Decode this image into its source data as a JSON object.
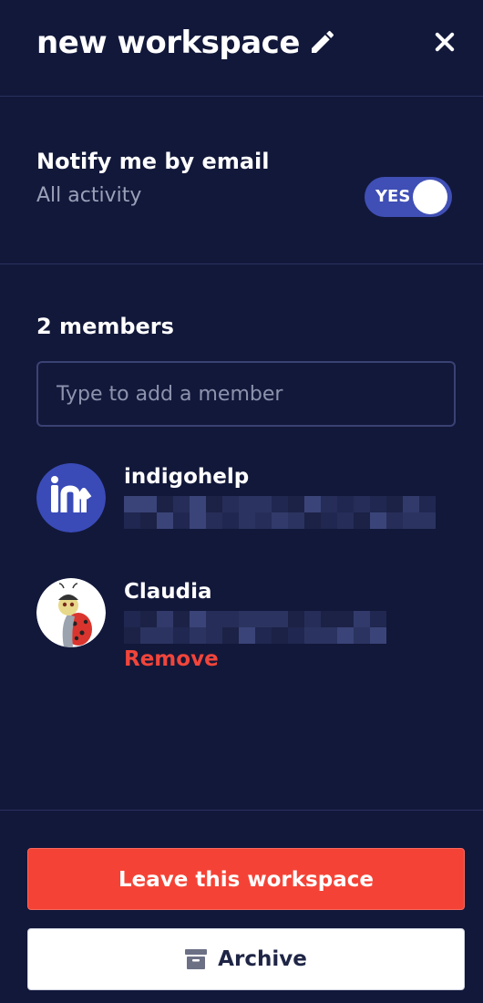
{
  "header": {
    "title": "new workspace",
    "edit_icon": "pencil-icon",
    "close_icon": "close-icon"
  },
  "notify": {
    "title": "Notify me by email",
    "subtitle": "All activity",
    "toggle_label": "YES",
    "toggle_on": true
  },
  "members": {
    "heading": "2 members",
    "input_placeholder": "Type to add a member",
    "list": [
      {
        "name": "indigohelp",
        "avatar": "indigo-logo-avatar",
        "remove_label": ""
      },
      {
        "name": "Claudia",
        "avatar": "ladybug-avatar",
        "remove_label": "Remove"
      }
    ]
  },
  "footer": {
    "leave_label": "Leave this workspace",
    "archive_label": "Archive",
    "archive_icon": "archive-box-icon"
  },
  "colors": {
    "background": "#12183a",
    "toggle": "#3f4fb5",
    "danger": "#f44336",
    "remove_text": "#f0453b"
  }
}
